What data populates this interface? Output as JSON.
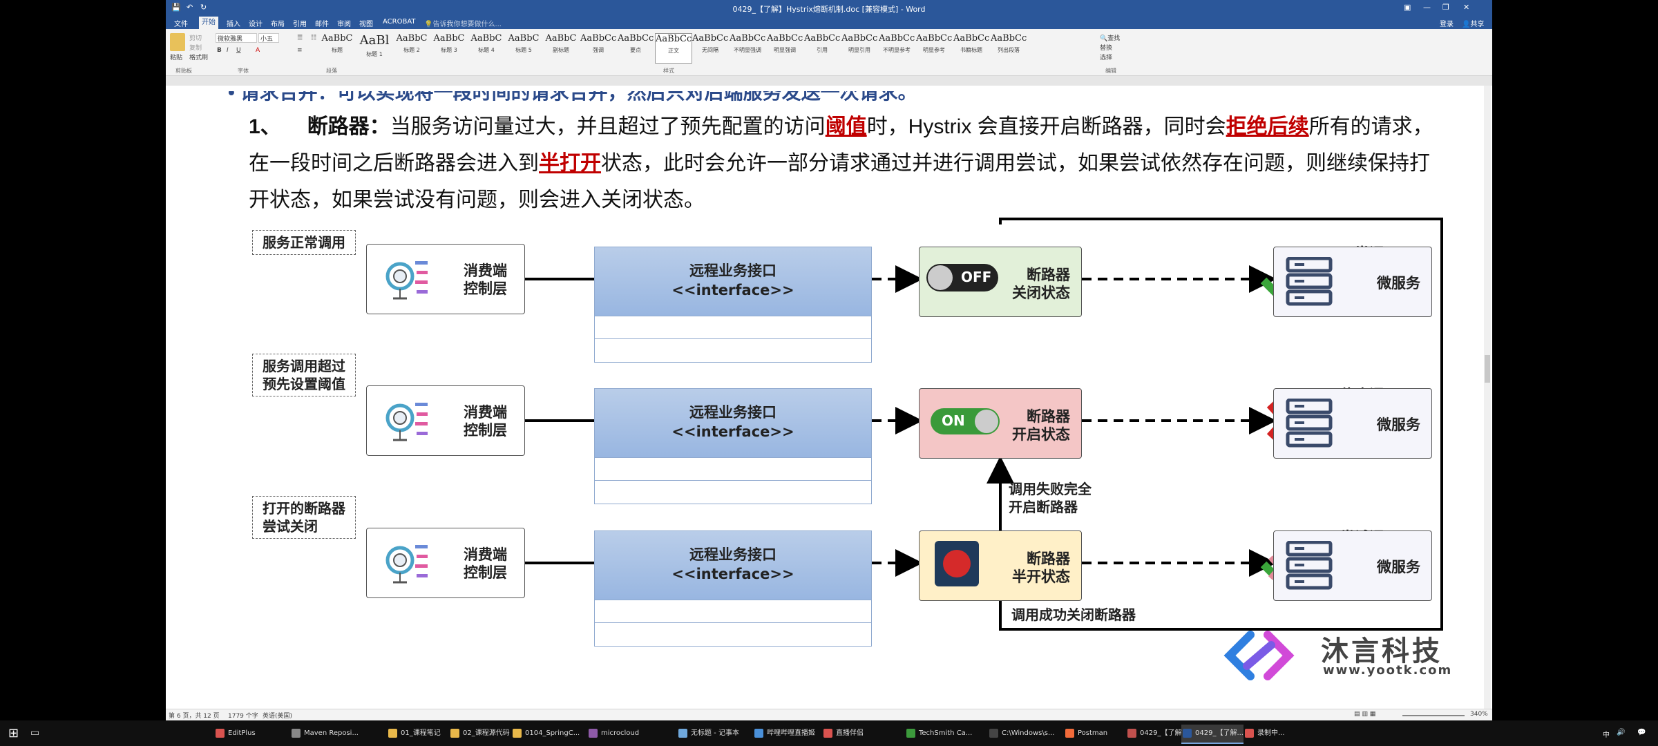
{
  "window": {
    "title": "0429_【了解】Hystrix熔断机制.doc [兼容模式] - Word",
    "login": "登录",
    "share": "共享"
  },
  "ribbon_tabs": [
    "文件",
    "开始",
    "插入",
    "设计",
    "布局",
    "引用",
    "邮件",
    "审阅",
    "视图",
    "ACROBAT"
  ],
  "tell_me": "告诉我你想要做什么...",
  "ribbon": {
    "paste": "粘贴",
    "clipboard_items": [
      "剪切",
      "复制",
      "格式刷"
    ],
    "font_name": "微软雅黑",
    "font_size": "小五",
    "groups": [
      "剪贴板",
      "字体",
      "段落",
      "样式",
      "编辑"
    ],
    "styles": [
      {
        "sample": "AaBbC",
        "name": "标题"
      },
      {
        "sample": "AaBl",
        "name": "标题 1"
      },
      {
        "sample": "AaBbC",
        "name": "标题 2"
      },
      {
        "sample": "AaBbC",
        "name": "标题 3"
      },
      {
        "sample": "AaBbC",
        "name": "标题 4"
      },
      {
        "sample": "AaBbC",
        "name": "标题 5"
      },
      {
        "sample": "AaBbC",
        "name": "副标题"
      },
      {
        "sample": "AaBbCcDc",
        "name": "强调"
      },
      {
        "sample": "AaBbCcD",
        "name": "要点"
      },
      {
        "sample": "AaBbCcDc",
        "name": "正文"
      },
      {
        "sample": "AaBbCcDc",
        "name": "无间隔"
      },
      {
        "sample": "AaBbCcDc",
        "name": "不明显强调"
      },
      {
        "sample": "AaBbCcDc",
        "name": "明显强调"
      },
      {
        "sample": "AaBbCcDc",
        "name": "引用"
      },
      {
        "sample": "AaBbCcDc",
        "name": "明显引用"
      },
      {
        "sample": "AaBbCcD",
        "name": "不明显参考"
      },
      {
        "sample": "AaBbCcD",
        "name": "明显参考"
      },
      {
        "sample": "AaBbCcI",
        "name": "书籍标题"
      },
      {
        "sample": "AaBbCcDc",
        "name": "列出段落"
      }
    ],
    "editing": [
      "查找",
      "替换",
      "选择"
    ]
  },
  "document": {
    "cut_line": "• 请求合并：可以实现将一段时间的请求合并，然后只对后端服务发送一次请求。",
    "para_num": "1、",
    "para_term": "断路器：",
    "line1_a": "当服务访问量过大，并且超过了预先配置的访问",
    "line1_red1": "阈值",
    "line1_b": "时，Hystrix 会直接开启断路器，同时会",
    "line1_red2": "拒绝后续",
    "line1_c": "所有的请求，",
    "line2_a": "在一段时间之后断路器会进入到",
    "line2_red": "半打开",
    "line2_b": "状态，此时会允许一部分请求通过并进行调用尝试，如果尝试依然存在问题，则继续保持打",
    "line3": "开状态，如果尝试没有问题，则会进入关闭状态。"
  },
  "diagram": {
    "consumer_label_1": "消费端",
    "consumer_label_2": "控制层",
    "interface_title": "远程业务接口",
    "interface_stereo": "<<interface>>",
    "breaker_label": "断路器",
    "micro_label": "微服务",
    "rows": [
      {
        "callout": "服务正常调用",
        "state": "关闭状态",
        "toggle": "OFF",
        "action": "正常调用",
        "mark": "check"
      },
      {
        "callout": "服务调用超过\n预先设置阈值",
        "state": "开启状态",
        "toggle": "ON",
        "action": "停止调用",
        "mark": "cross"
      },
      {
        "callout": "打开的断路器\n尝试关闭",
        "state": "半开状态",
        "toggle": "",
        "action": "尝试调用",
        "mark": "half"
      }
    ],
    "fail_label_1": "调用失败完全",
    "fail_label_2": "开启断路器",
    "success_label": "调用成功关闭断路器",
    "logo_name": "沐言科技",
    "logo_url": "www.yootk.com"
  },
  "status": {
    "page": "第 6 页，共 12 页",
    "words": "1779 个字",
    "lang": "英语(美国)",
    "zoom": "340%"
  },
  "taskbar": [
    {
      "label": "EditPlus",
      "color": "#d9534f"
    },
    {
      "label": "Maven Reposi...",
      "color": "#888"
    },
    {
      "label": "01_课程笔记",
      "color": "#e8b84a"
    },
    {
      "label": "02_课程源代码",
      "color": "#e8b84a"
    },
    {
      "label": "0104_SpringC...",
      "color": "#e8b84a"
    },
    {
      "label": "microcloud",
      "color": "#8e5aa8"
    },
    {
      "label": "无标题 - 记事本",
      "color": "#6fa8dc"
    },
    {
      "label": "哔哩哔哩直播姬",
      "color": "#4a90d9"
    },
    {
      "label": "直播伴侣",
      "color": "#d9534f"
    },
    {
      "label": "TechSmith Ca...",
      "color": "#3c9a3c"
    },
    {
      "label": "C:\\Windows\\s...",
      "color": "#444"
    },
    {
      "label": "Postman",
      "color": "#f26b3a"
    },
    {
      "label": "0429_【了解...",
      "color": "#c0504d"
    },
    {
      "label": "0429_【了解...",
      "color": "#2b579a"
    },
    {
      "label": "录制中...",
      "color": "#d9534f"
    }
  ],
  "clock": {
    "lang": "中"
  }
}
